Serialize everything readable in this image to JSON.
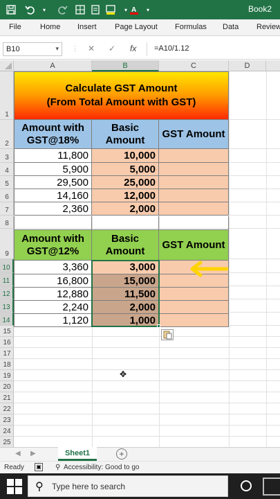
{
  "window": {
    "book_title": "Book2",
    "colors": {
      "excel_green": "#217346",
      "title_gradient": [
        "#ffe600",
        "#ff2a00"
      ],
      "header_blue": "#9dc3e6",
      "header_green": "#92d050",
      "cell_peach": "#f8cbad",
      "cell_tan": "#c9a58b"
    }
  },
  "titlebar": {
    "icons": [
      "save-icon",
      "undo-icon",
      "redo-icon",
      "borders-icon",
      "sheet-icon",
      "fill-color-icon",
      "font-color-icon"
    ]
  },
  "ribbon": {
    "tabs": [
      "File",
      "Home",
      "Insert",
      "Page Layout",
      "Formulas",
      "Data",
      "Review"
    ]
  },
  "formula_bar": {
    "name_box": "B10",
    "cancel_symbol": "✕",
    "enter_symbol": "✓",
    "fx_symbol": "fx",
    "formula": "=A10/1.12"
  },
  "columns": [
    "A",
    "B",
    "C",
    "D"
  ],
  "rows": [
    "1",
    "2",
    "3",
    "4",
    "5",
    "6",
    "7",
    "8",
    "9",
    "10",
    "11",
    "12",
    "13",
    "14",
    "15",
    "16",
    "17",
    "18",
    "19",
    "20",
    "21",
    "22",
    "23",
    "24",
    "25"
  ],
  "sheet": {
    "title_line1": "Calculate GST Amount",
    "title_line2": "(From Total Amount with GST)",
    "table1": {
      "headers": [
        "Amount with GST@18%",
        "Basic Amount",
        "GST Amount"
      ],
      "rows": [
        [
          "11,800",
          "10,000",
          ""
        ],
        [
          "5,900",
          "5,000",
          ""
        ],
        [
          "29,500",
          "25,000",
          ""
        ],
        [
          "14,160",
          "12,000",
          ""
        ],
        [
          "2,360",
          "2,000",
          ""
        ]
      ]
    },
    "table2": {
      "headers": [
        "Amount with GST@12%",
        "Basic Amount",
        "GST Amount"
      ],
      "rows": [
        [
          "3,360",
          "3,000",
          ""
        ],
        [
          "16,800",
          "15,000",
          ""
        ],
        [
          "12,880",
          "11,500",
          ""
        ],
        [
          "2,240",
          "2,000",
          ""
        ],
        [
          "1,120",
          "1,000",
          ""
        ]
      ]
    }
  },
  "sheet_tabs": {
    "active": "Sheet1",
    "add_symbol": "+"
  },
  "status": {
    "ready": "Ready",
    "accessibility": "Accessibility: Good to go"
  },
  "taskbar": {
    "search_placeholder": "Type here to search"
  }
}
